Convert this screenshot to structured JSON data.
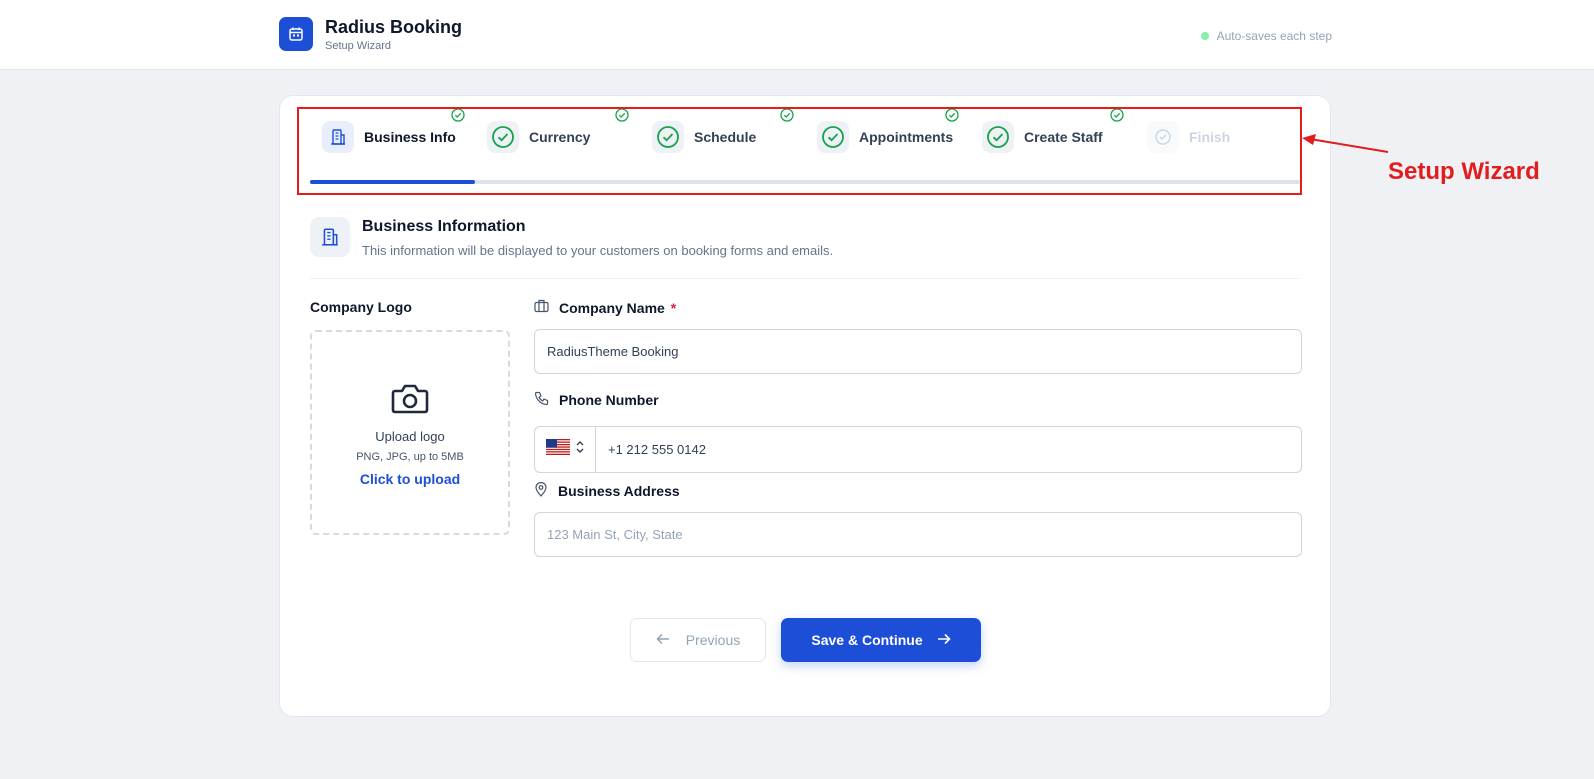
{
  "header": {
    "title": "Radius Booking",
    "subtitle": "Setup Wizard",
    "autosave_text": "Auto-saves each step"
  },
  "stepper": {
    "steps": [
      {
        "label": "Business Info",
        "state": "active",
        "completed": true
      },
      {
        "label": "Currency",
        "state": "done",
        "completed": true
      },
      {
        "label": "Schedule",
        "state": "done",
        "completed": true
      },
      {
        "label": "Appointments",
        "state": "done",
        "completed": true
      },
      {
        "label": "Create Staff",
        "state": "done",
        "completed": true
      },
      {
        "label": "Finish",
        "state": "disabled",
        "completed": false
      }
    ],
    "progress_fraction": 0.1667
  },
  "annotation": {
    "label": "Setup Wizard",
    "color": "#e11d1d"
  },
  "section": {
    "title": "Business Information",
    "description": "This information will be displayed to your customers on booking forms and emails."
  },
  "logo_upload": {
    "label": "Company Logo",
    "title": "Upload logo",
    "hint": "PNG, JPG, up to 5MB",
    "link": "Click to upload"
  },
  "fields": {
    "company_name": {
      "label": "Company Name",
      "required_mark": "*",
      "value": "RadiusTheme Booking"
    },
    "phone": {
      "label": "Phone Number",
      "country_flag": "US",
      "value": "+1 212 555 0142"
    },
    "address": {
      "label": "Business Address",
      "placeholder": "123 Main St, City, State"
    }
  },
  "buttons": {
    "previous": "Previous",
    "save_continue": "Save & Continue"
  },
  "colors": {
    "accent": "#1d4ed8",
    "success": "#16a34a",
    "background": "#f0f1f4"
  }
}
